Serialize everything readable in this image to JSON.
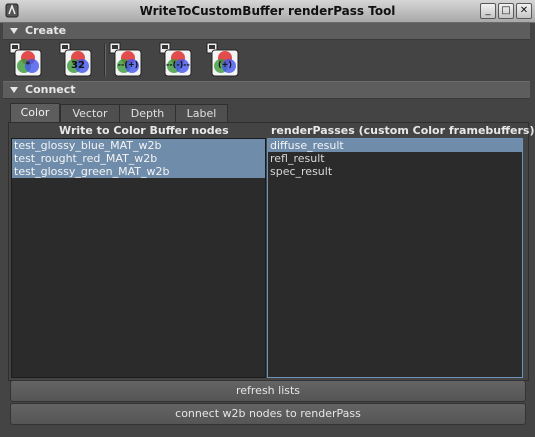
{
  "window": {
    "title": "WriteToCustomBuffer renderPass Tool",
    "controls": {
      "minimize": "_",
      "maximize": "□",
      "close": "✕"
    }
  },
  "frames": {
    "create": {
      "label": "Create"
    },
    "connect": {
      "label": "Connect"
    }
  },
  "toolbar": {
    "buttons": [
      {
        "icon": "rgb-write-color-icon",
        "text": "*"
      },
      {
        "icon": "rgb-write-32bit-icon",
        "text": "32"
      },
      {
        "icon": "rgb-add-icon",
        "text": "--(+)"
      },
      {
        "icon": "rgb-subtract-icon",
        "text": "--(-)--"
      },
      {
        "icon": "rgb-add-alt-icon",
        "text": "(+)"
      }
    ]
  },
  "tabs": [
    "Color",
    "Vector",
    "Depth",
    "Label"
  ],
  "active_tab": "Color",
  "left_list": {
    "header": "Write to Color Buffer nodes",
    "items": [
      "test_glossy_blue_MAT_w2b",
      "test_rought_red_MAT_w2b",
      "test_glossy_green_MAT_w2b"
    ],
    "selected": [
      0,
      1,
      2
    ]
  },
  "right_list": {
    "header": "renderPasses (custom Color framebuffers)",
    "items": [
      "diffuse_result",
      "refl_result",
      "spec_result"
    ],
    "selected": [
      0
    ]
  },
  "buttons": {
    "refresh": "refresh lists",
    "connect": "connect w2b nodes to renderPass"
  },
  "colors": {
    "background": "#444444",
    "selection": "#6f8cab",
    "list_bg": "#2b2b2b"
  }
}
